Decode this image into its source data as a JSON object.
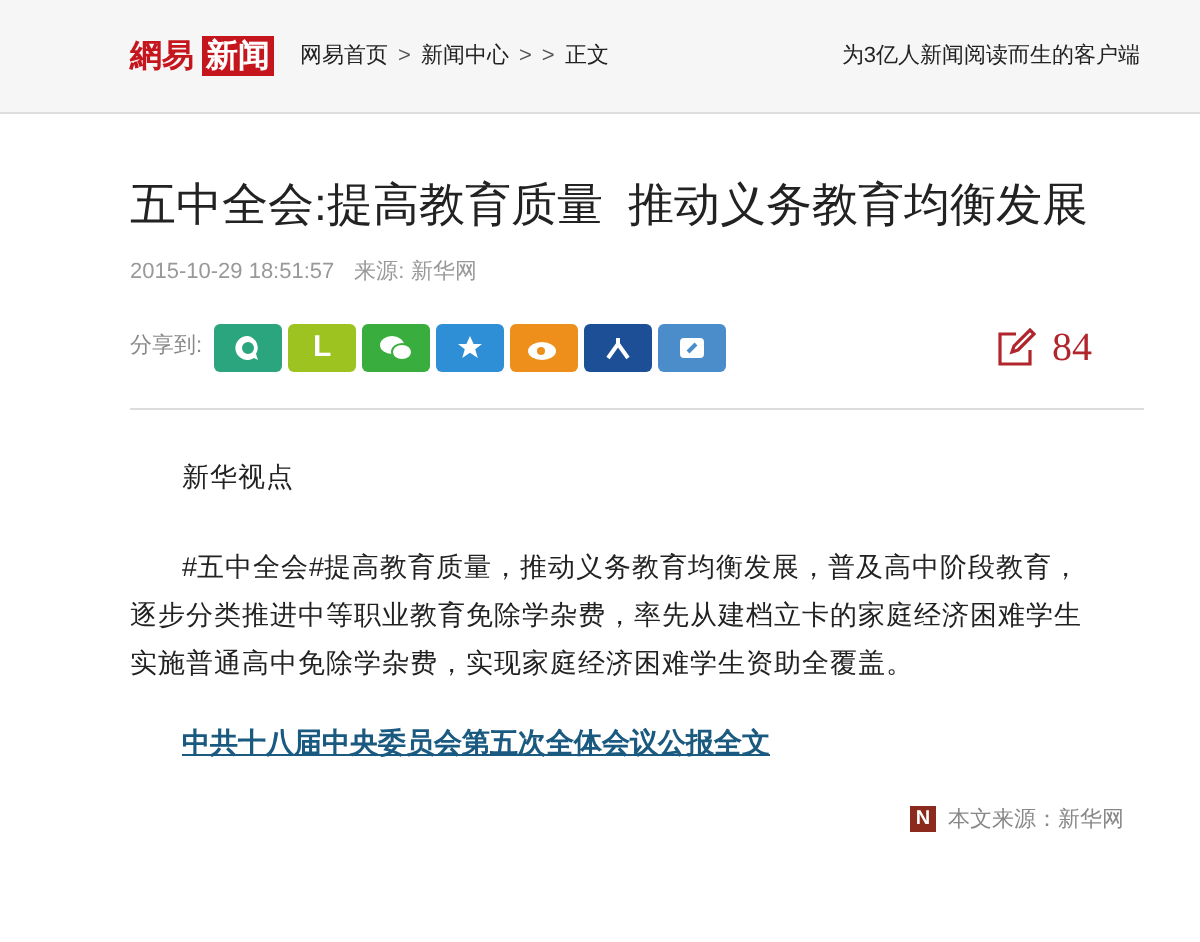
{
  "header": {
    "logo": {
      "part_1": "網易",
      "part_2": "新闻"
    },
    "breadcrumb": [
      {
        "kind": "link",
        "text": "网易首页"
      },
      {
        "kind": "sep",
        "text": ">"
      },
      {
        "kind": "link",
        "text": "新闻中心"
      },
      {
        "kind": "sep",
        "text": ">"
      },
      {
        "kind": "sep",
        "text": ">"
      },
      {
        "kind": "link",
        "text": "正文"
      }
    ],
    "slogan": "为3亿人新闻阅读而生的客户端"
  },
  "article": {
    "title": "五中全会:提高教育质量  推动义务教育均衡发展",
    "date": "2015-10-29 18:51:57",
    "source": "来源: 新华网",
    "share": {
      "label": "分享到:",
      "buttons": [
        {
          "kind": "bubble",
          "color": "#2aa57e"
        },
        {
          "kind": "letter",
          "text": "L",
          "color": "#9cc31f"
        },
        {
          "kind": "chat",
          "color": "#3aad3f"
        },
        {
          "kind": "star",
          "color": "#2e8ed6"
        },
        {
          "kind": "eye",
          "color": "#ee8f1c"
        },
        {
          "kind": "person",
          "color": "#1d4f97"
        },
        {
          "kind": "note",
          "color": "#4b8ccb"
        }
      ]
    },
    "comment_count": "84",
    "paragraphs": [
      {
        "kind": "plain",
        "text": "新华视点"
      },
      {
        "kind": "plain",
        "text": "#五中全会#提高教育质量，推动义务教育均衡发展，普及高中阶段教育，逐步分类推进中等职业教育免除学杂费，率先从建档立卡的家庭经济困难学生实施普通高中免除学杂费，实现家庭经济困难学生资助全覆盖。"
      },
      {
        "kind": "link",
        "text": "中共十八届中央委员会第五次全体会议公报全文"
      }
    ],
    "footer_source": {
      "badge": "N",
      "text": "本文来源：新华网"
    }
  }
}
